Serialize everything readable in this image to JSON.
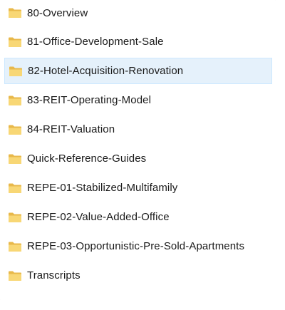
{
  "folders": [
    {
      "label": "80-Overview",
      "selected": false
    },
    {
      "label": "81-Office-Development-Sale",
      "selected": false
    },
    {
      "label": "82-Hotel-Acquisition-Renovation",
      "selected": true
    },
    {
      "label": "83-REIT-Operating-Model",
      "selected": false
    },
    {
      "label": "84-REIT-Valuation",
      "selected": false
    },
    {
      "label": "Quick-Reference-Guides",
      "selected": false
    },
    {
      "label": "REPE-01-Stabilized-Multifamily",
      "selected": false
    },
    {
      "label": "REPE-02-Value-Added-Office",
      "selected": false
    },
    {
      "label": "REPE-03-Opportunistic-Pre-Sold-Apartments",
      "selected": false
    },
    {
      "label": "Transcripts",
      "selected": false
    }
  ],
  "colors": {
    "folder_body": "#f8d775",
    "folder_back": "#e8b84a",
    "selection_bg": "#e5f1fb",
    "selection_border": "#cce8ff"
  },
  "icons": {
    "folder": "folder-icon"
  }
}
